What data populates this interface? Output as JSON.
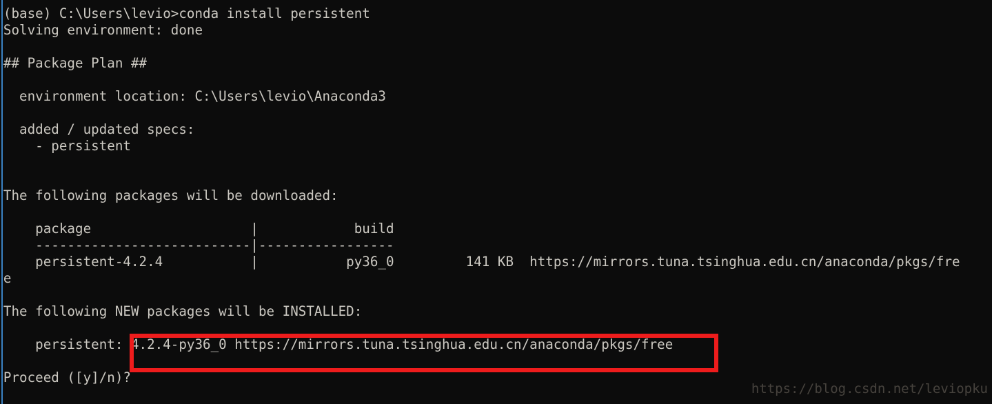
{
  "window": {
    "background_color": "#0c0c0c",
    "text_color": "#ccc9c2",
    "left_edge_color": "#3a82c4",
    "highlight_color": "#ee1c1c",
    "watermark_color": "#46423d"
  },
  "terminal": {
    "lines": [
      "(base) C:\\Users\\levio>conda install persistent",
      "Solving environment: done",
      "",
      "## Package Plan ##",
      "",
      "  environment location: C:\\Users\\levio\\Anaconda3",
      "",
      "  added / updated specs:",
      "    - persistent",
      "",
      "",
      "The following packages will be downloaded:",
      "",
      "    package                    |            build",
      "    ---------------------------|-----------------",
      "    persistent-4.2.4           |           py36_0         141 KB  https://mirrors.tuna.tsinghua.edu.cn/anaconda/pkgs/fre",
      "e",
      "",
      "The following NEW packages will be INSTALLED:",
      "",
      "    persistent: 4.2.4-py36_0 https://mirrors.tuna.tsinghua.edu.cn/anaconda/pkgs/free",
      "",
      "Proceed ([y]/n)?"
    ],
    "command": "conda install persistent",
    "prompt": "(base) C:\\Users\\levio>",
    "solving_status": "Solving environment: done",
    "plan_header": "## Package Plan ##",
    "environment_location": "C:\\Users\\levio\\Anaconda3",
    "added_updated_specs": [
      "persistent"
    ],
    "download_header": "The following packages will be downloaded:",
    "install_header": "The following NEW packages will be INSTALLED:",
    "proceed_prompt": "Proceed ([y]/n)?"
  },
  "package_table": {
    "columns": [
      "package",
      "build"
    ],
    "rows": [
      {
        "package": "persistent-4.2.4",
        "build": "py36_0",
        "size": "141 KB",
        "channel": "https://mirrors.tuna.tsinghua.edu.cn/anaconda/pkgs/free"
      }
    ]
  },
  "installed_packages": [
    {
      "name": "persistent:",
      "spec": "4.2.4-py36_0",
      "channel": "https://mirrors.tuna.tsinghua.edu.cn/anaconda/pkgs/free"
    }
  ],
  "annotation": {
    "highlighted_text": "4.2.4-py36_0 https://mirrors.tuna.tsinghua.edu.cn/anaconda/pkgs/free"
  },
  "watermark": {
    "text": "https://blog.csdn.net/leviopku"
  }
}
